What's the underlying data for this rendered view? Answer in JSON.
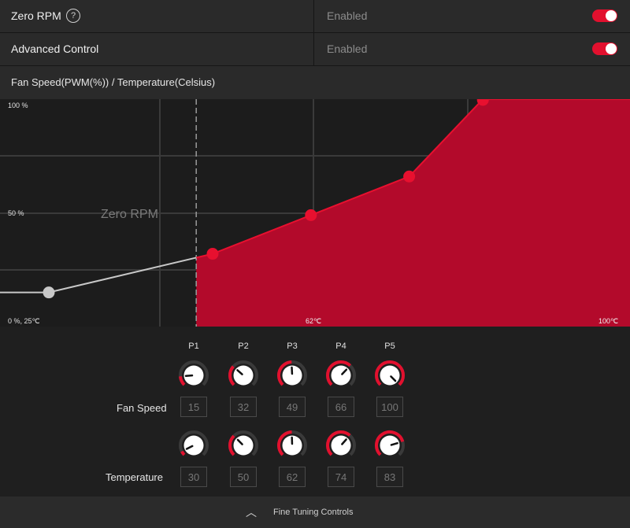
{
  "settings": {
    "zero_rpm": {
      "label": "Zero RPM",
      "help_glyph": "?",
      "value": "Enabled",
      "toggle_on": true
    },
    "advanced_control": {
      "label": "Advanced Control",
      "value": "Enabled",
      "toggle_on": true
    }
  },
  "graph": {
    "title": "Fan Speed(PWM(%)) / Temperature(Celsius)"
  },
  "chart_data": {
    "type": "area",
    "x": [
      25,
      30,
      50,
      62,
      74,
      83,
      100
    ],
    "y": [
      15,
      15,
      32,
      49,
      66,
      100,
      100
    ],
    "xlim": [
      25,
      100
    ],
    "ylim": [
      0,
      100
    ],
    "zero_rpm_threshold": 48,
    "zero_rpm_label": "Zero RPM",
    "tick_labels": {
      "y_top": "100 %",
      "y_mid": "50 %",
      "origin": "0 %, 25℃",
      "x_mid": "62℃",
      "x_right": "100℃"
    },
    "grid": true,
    "colors": {
      "active_fill": "#b30a2b",
      "active_point": "#e8102f",
      "inactive_line": "#c8c8c8",
      "inactive_point": "#c8c8c8",
      "grid": "#3a3a3a",
      "threshold": "#9a9a9a"
    }
  },
  "controls": {
    "points": [
      "P1",
      "P2",
      "P3",
      "P4",
      "P5"
    ],
    "fan_speed_label": "Fan Speed",
    "temperature_label": "Temperature",
    "fan_speed": [
      15,
      32,
      49,
      66,
      100
    ],
    "temperature": [
      30,
      50,
      62,
      74,
      83
    ]
  },
  "footer": {
    "label": "Fine Tuning Controls",
    "icon": "chevron-up-icon"
  }
}
